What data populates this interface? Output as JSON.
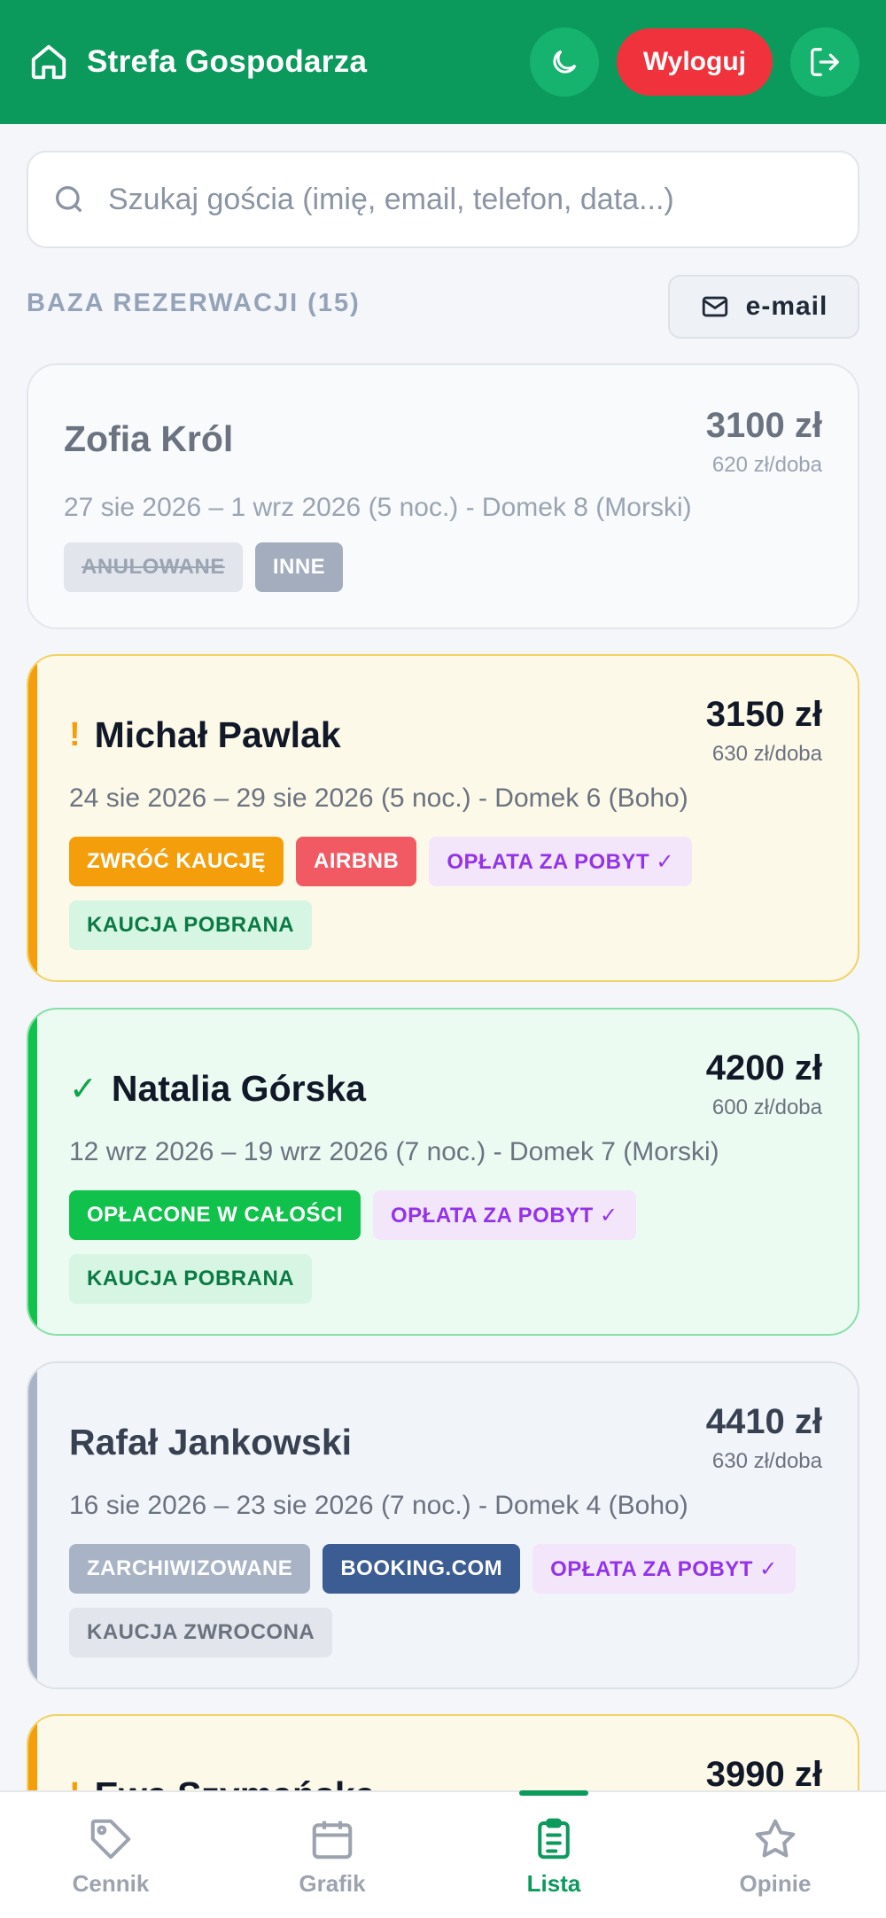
{
  "header": {
    "title": "Strefa Gospodarza",
    "logout_label": "Wyloguj"
  },
  "search": {
    "placeholder": "Szukaj gościa (imię, email, telefon, data...)"
  },
  "list": {
    "section_title": "BAZA REZERWACJI (15)",
    "email_label": "e-mail"
  },
  "reservations": [
    {
      "name": "Zofia Król",
      "mark": "",
      "price": "3100 zł",
      "per_night": "620 zł/doba",
      "dates": "27 sie 2026 – 1 wrz 2026 (5 noc.) - Domek 8 (Morski)",
      "tags": [
        "ANULOWANE",
        "INNE"
      ]
    },
    {
      "name": "Michał Pawlak",
      "mark": "!",
      "price": "3150 zł",
      "per_night": "630 zł/doba",
      "dates": "24 sie 2026 – 29 sie 2026 (5 noc.) - Domek 6 (Boho)",
      "tags": [
        "ZWRÓĆ KAUCJĘ",
        "AIRBNB",
        "OPŁATA ZA POBYT ✓",
        "KAUCJA POBRANA"
      ]
    },
    {
      "name": "Natalia Górska",
      "mark": "✓",
      "price": "4200 zł",
      "per_night": "600 zł/doba",
      "dates": "12 wrz 2026 – 19 wrz 2026 (7 noc.) - Domek 7 (Morski)",
      "tags": [
        "OPŁACONE W CAŁOŚCI",
        "OPŁATA ZA POBYT ✓",
        "KAUCJA POBRANA"
      ]
    },
    {
      "name": "Rafał Jankowski",
      "mark": "",
      "price": "4410 zł",
      "per_night": "630 zł/doba",
      "dates": "16 sie 2026 – 23 sie 2026 (7 noc.) - Domek 4 (Boho)",
      "tags": [
        "ZARCHIWIZOWANE",
        "BOOKING.COM",
        "OPŁATA ZA POBYT ✓",
        "KAUCJA ZWROCONA"
      ]
    },
    {
      "name": "Ewa Szymańska",
      "mark": "!",
      "price": "3990 zł"
    }
  ],
  "nav": {
    "items": [
      "Cennik",
      "Grafik",
      "Lista",
      "Opinie"
    ],
    "active": "Lista"
  },
  "colors": {
    "brand": "#0b9a5c",
    "danger": "#f0323c",
    "warning": "#f59e0b",
    "success": "#10c24b"
  }
}
